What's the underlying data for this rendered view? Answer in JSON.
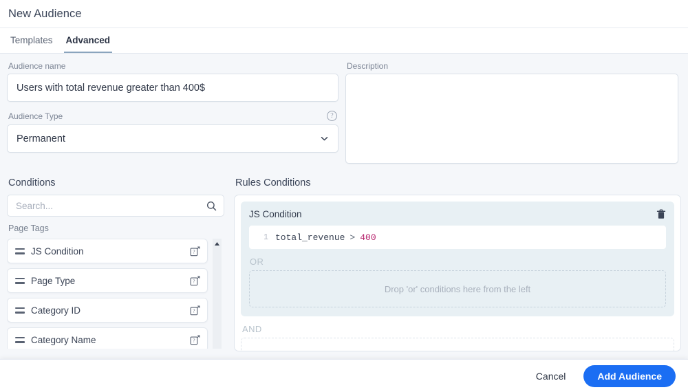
{
  "header": {
    "title": "New Audience"
  },
  "tabs": [
    {
      "label": "Templates",
      "active": false
    },
    {
      "label": "Advanced",
      "active": true
    }
  ],
  "form": {
    "audience_name_label": "Audience name",
    "audience_name_value": "Users with total revenue greater than 400$",
    "audience_type_label": "Audience Type",
    "audience_type_value": "Permanent",
    "audience_type_help_icon": "help-circle-icon",
    "description_label": "Description",
    "description_value": "",
    "description_placeholder": ""
  },
  "conditions": {
    "title": "Conditions",
    "search_placeholder": "Search...",
    "search_value": "",
    "search_icon": "search-icon",
    "group_label": "Page Tags",
    "items": [
      {
        "label": "JS Condition",
        "drag_icon": "drag-handle-icon",
        "doc_icon": "doc-link-icon"
      },
      {
        "label": "Page Type",
        "drag_icon": "drag-handle-icon",
        "doc_icon": "doc-link-icon"
      },
      {
        "label": "Category ID",
        "drag_icon": "drag-handle-icon",
        "doc_icon": "doc-link-icon"
      },
      {
        "label": "Category Name",
        "drag_icon": "drag-handle-icon",
        "doc_icon": "doc-link-icon"
      }
    ],
    "scroll_up_icon": "caret-up-icon"
  },
  "rules": {
    "title": "Rules Conditions",
    "card": {
      "title": "JS Condition",
      "delete_icon": "trash-icon",
      "code_line_number": "1",
      "code_identifier": "total_revenue",
      "code_operator": ">",
      "code_value": "400",
      "or_label": "OR",
      "or_dropzone_text": "Drop 'or' conditions here from the left"
    },
    "and_label": "AND",
    "and_dropzone_text": ""
  },
  "footer": {
    "cancel_label": "Cancel",
    "submit_label": "Add Audience"
  },
  "colors": {
    "primary": "#1b6ef3",
    "page_bg": "#f5f7fa",
    "card_bg": "#e8f0f4",
    "code_number": "#b5216b",
    "tab_underline": "#8aa4bd"
  }
}
